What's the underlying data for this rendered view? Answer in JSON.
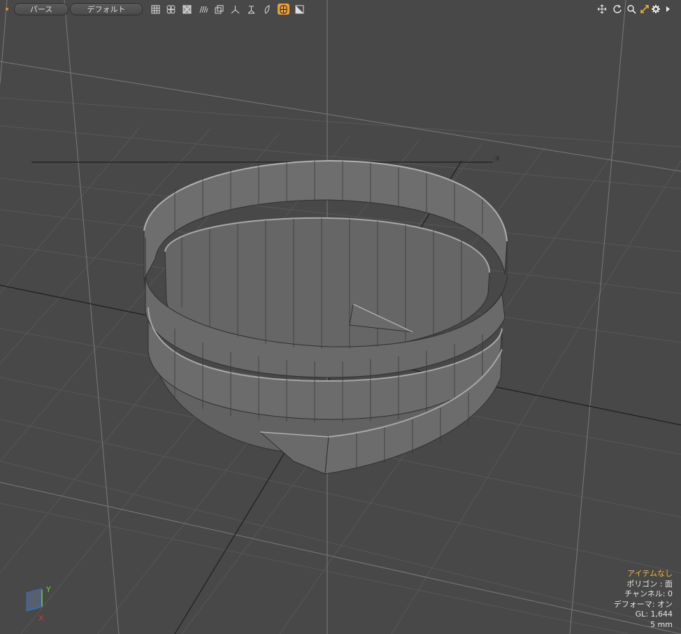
{
  "toolbar": {
    "view_mode": "パース",
    "shading_mode": "デフォルト",
    "icons": [
      "wireframe-grid-icon",
      "vertex-cluster-icon",
      "shaded-box-icon",
      "texture-wave-icon",
      "box-frame-icon",
      "axis-tripod-icon",
      "item-base-icon",
      "surface-fill-icon",
      "mesh-active-icon",
      "gradient-corner-icon"
    ],
    "active_icon": "mesh-active-icon",
    "right_icons": [
      "move-view-icon",
      "rotate-view-icon",
      "zoom-icon",
      "maximize-icon",
      "gear-icon",
      "chevron-right-icon"
    ]
  },
  "viewport": {
    "axis_hint": "-X",
    "axis_widget": {
      "x_label": "X",
      "y_label": "Y"
    }
  },
  "info": {
    "item": "アイテムなし",
    "polygon": "ポリゴン : 面",
    "channels": "チャンネル: 0",
    "deformer": "デフォーマ: オン",
    "gl": "GL: 1,644",
    "scale": "5 mm"
  },
  "colors": {
    "background": "#484848",
    "grid": "#5a5a5a",
    "grid_major": "#7c7c7c",
    "mesh_face": "#6b6b6b",
    "mesh_top": "#a6a6a6",
    "accent": "#e8a03a",
    "info_highlight": "#f2b43a",
    "axis_x": "#d03a2c",
    "axis_y": "#6ad04a"
  }
}
